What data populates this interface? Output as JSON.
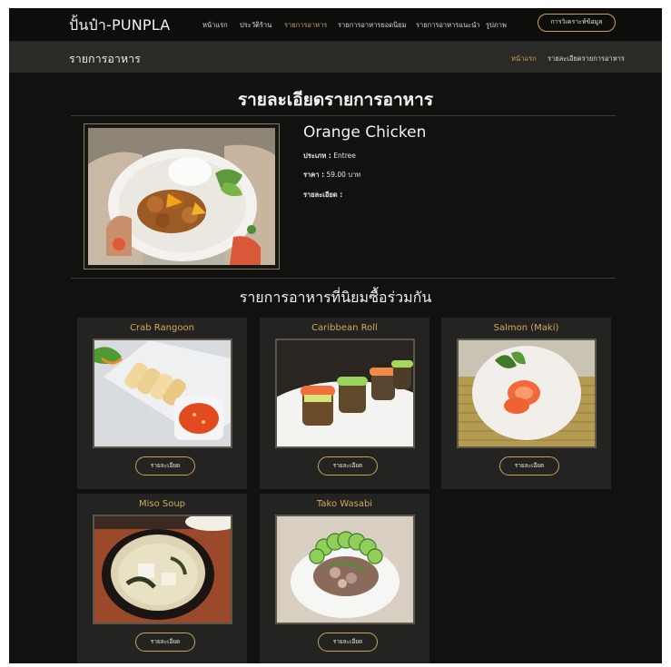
{
  "brand": "ปั้นป๋า-PUNPLA",
  "nav": {
    "items": [
      {
        "label": "หน้าแรก"
      },
      {
        "label": "ประวัติร้าน"
      },
      {
        "label": "รายการอาหาร"
      },
      {
        "label": "รายการอาหารยอดนิยม"
      },
      {
        "label": "รายการอาหารแนะนำ"
      },
      {
        "label": "รูปภาพ"
      }
    ],
    "active_index": 2,
    "analyze_button": "การวิเคราะห์ข้อมูล"
  },
  "subbar": {
    "title": "รายการอาหาร",
    "breadcrumb": {
      "home": "หน้าแรก",
      "current": "รายละเอียดรายการอาหาร"
    }
  },
  "page_title": "รายละเอียดรายการอาหาร",
  "dish": {
    "name": "Orange Chicken",
    "type_label": "ประเภท :",
    "type_value": "Entree",
    "price_label": "ราคา :",
    "price_value": "59.00 บาท",
    "detail_label": "รายละเอียด :",
    "detail_value": ""
  },
  "popular": {
    "heading": "รายการอาหารที่นิยมซื้อร่วมกัน",
    "button_label": "รายละเอียด",
    "items": [
      {
        "name": "Crab Rangoon"
      },
      {
        "name": "Caribbean Roll"
      },
      {
        "name": "Salmon (Maki)"
      },
      {
        "name": "Miso Soup"
      },
      {
        "name": "Tako Wasabi"
      }
    ]
  },
  "colors": {
    "accent": "#c9a25a",
    "background": "#111110",
    "card": "#232321",
    "subbar": "#2a2a27"
  }
}
